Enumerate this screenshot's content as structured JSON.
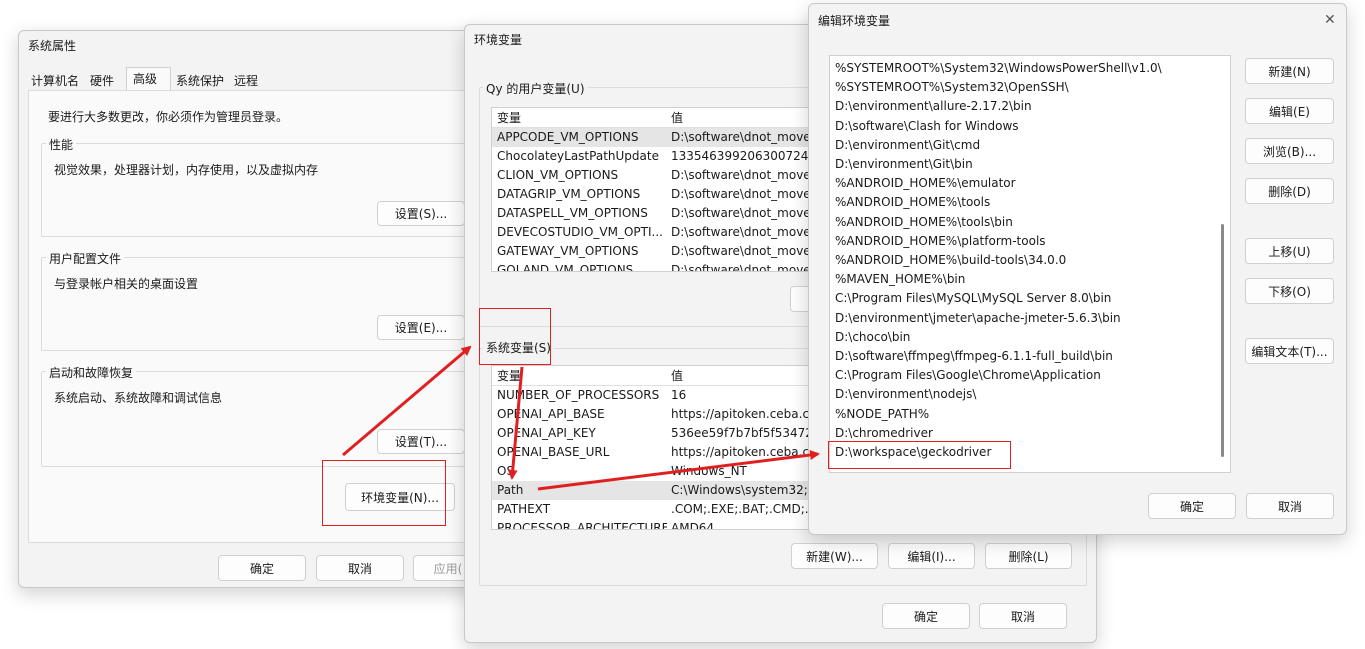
{
  "system_properties": {
    "title": "系统属性",
    "tabs": [
      "计算机名",
      "硬件",
      "高级",
      "系统保护",
      "远程"
    ],
    "notice": "要进行大多数更改，你必须作为管理员登录。",
    "performance": {
      "label": "性能",
      "desc": "视觉效果，处理器计划，内存使用，以及虚拟内存",
      "button": "设置(S)..."
    },
    "user_profiles": {
      "label": "用户配置文件",
      "desc": "与登录帐户相关的桌面设置",
      "button": "设置(E)..."
    },
    "startup": {
      "label": "启动和故障恢复",
      "desc": "系统启动、系统故障和调试信息",
      "button": "设置(T)..."
    },
    "env_button": "环境变量(N)...",
    "ok": "确定",
    "cancel": "取消",
    "apply": "应用("
  },
  "env_vars": {
    "title": "环境变量",
    "user_section": "Qy 的用户变量(U)",
    "col_var": "变量",
    "col_val": "值",
    "user_rows": [
      {
        "name": "APPCODE_VM_OPTIONS",
        "value": "D:\\software\\dnot_move"
      },
      {
        "name": "ChocolateyLastPathUpdate",
        "value": "133546399206300724"
      },
      {
        "name": "CLION_VM_OPTIONS",
        "value": "D:\\software\\dnot_move"
      },
      {
        "name": "DATAGRIP_VM_OPTIONS",
        "value": "D:\\software\\dnot_move"
      },
      {
        "name": "DATASPELL_VM_OPTIONS",
        "value": "D:\\software\\dnot_move"
      },
      {
        "name": "DEVECOSTUDIO_VM_OPTI...",
        "value": "D:\\software\\dnot_move"
      },
      {
        "name": "GATEWAY_VM_OPTIONS",
        "value": "D:\\software\\dnot_move"
      },
      {
        "name": "GOLAND_VM_OPTIONS",
        "value": "D:\\software\\dnot_move"
      }
    ],
    "system_section": "系统变量(S)",
    "system_rows": [
      {
        "name": "NUMBER_OF_PROCESSORS",
        "value": "16"
      },
      {
        "name": "OPENAI_API_BASE",
        "value": "https://apitoken.ceba.c"
      },
      {
        "name": "OPENAI_API_KEY",
        "value": "536ee59f7b7bf5f534729"
      },
      {
        "name": "OPENAI_BASE_URL",
        "value": "https://apitoken.ceba.c"
      },
      {
        "name": "OS",
        "value": "Windows_NT"
      },
      {
        "name": "Path",
        "value": "C:\\Windows\\system32;D"
      },
      {
        "name": "PATHEXT",
        "value": ".COM;.EXE;.BAT;.CMD;.V"
      },
      {
        "name": "PROCESSOR_ARCHITECTURE",
        "value": "AMD64"
      }
    ],
    "new": "新建(W)...",
    "edit": "编辑(I)...",
    "delete": "删除(L)",
    "ok": "确定",
    "cancel": "取消"
  },
  "edit_env": {
    "title": "编辑环境变量",
    "close": "✕",
    "entries": [
      "%SYSTEMROOT%\\System32\\WindowsPowerShell\\v1.0\\",
      "%SYSTEMROOT%\\System32\\OpenSSH\\",
      "D:\\environment\\allure-2.17.2\\bin",
      "D:\\software\\Clash for Windows",
      "D:\\environment\\Git\\cmd",
      "D:\\environment\\Git\\bin",
      "%ANDROID_HOME%\\emulator",
      "%ANDROID_HOME%\\tools",
      "%ANDROID_HOME%\\tools\\bin",
      "%ANDROID_HOME%\\platform-tools",
      "%ANDROID_HOME%\\build-tools\\34.0.0",
      "%MAVEN_HOME%\\bin",
      "C:\\Program Files\\MySQL\\MySQL Server 8.0\\bin",
      "D:\\environment\\jmeter\\apache-jmeter-5.6.3\\bin",
      "D:\\choco\\bin",
      "D:\\software\\ffmpeg\\ffmpeg-6.1.1-full_build\\bin",
      "C:\\Program Files\\Google\\Chrome\\Application",
      "D:\\environment\\nodejs\\",
      "%NODE_PATH%",
      "D:\\chromedriver",
      "D:\\workspace\\geckodriver"
    ],
    "buttons": {
      "new": "新建(N)",
      "edit": "编辑(E)",
      "browse": "浏览(B)...",
      "delete": "删除(D)",
      "up": "上移(U)",
      "down": "下移(O)",
      "edit_text": "编辑文本(T)..."
    },
    "ok": "确定",
    "cancel": "取消"
  },
  "colors": {
    "annotation_red": "#e02020",
    "window_bg": "#f3f3f3",
    "selected_row": "#e5e5e5"
  }
}
